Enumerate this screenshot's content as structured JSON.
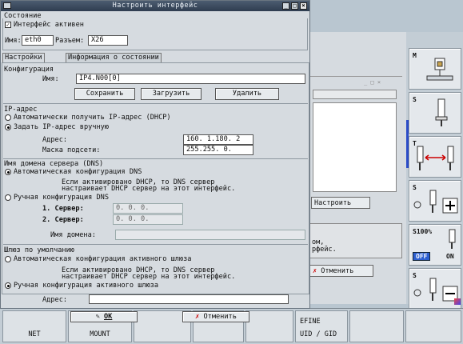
{
  "window": {
    "title": "Настроить интерфейс",
    "status_group": "Состояние",
    "iface_active_label": "Интерфейс активен",
    "name_label": "Имя:",
    "name_value": "eth0",
    "connector_label": "Разъем:",
    "connector_value": "X26"
  },
  "tabs": [
    "Настройки",
    "Информация о состоянии"
  ],
  "config": {
    "group": "Конфигурация",
    "name_label": "Имя:",
    "name_value": "IP4.N00[0]",
    "save": "Сохранить",
    "load": "Загрузить",
    "delete": "Удалить"
  },
  "ip": {
    "group": "IP-адрес",
    "auto": "Автоматически получить IP-адрес (DHCP)",
    "manual": "Задать IP-адрес вручную",
    "address_label": "Адрес:",
    "address_value": "160.  1.180. 2",
    "mask_label": "Маска подсети:",
    "mask_value": "255.255.  0."
  },
  "dns": {
    "group": "Имя домена сервера (DNS)",
    "auto": "Автоматическая конфигурация DNS",
    "note1": "Если активировано DHCP, то DNS сервер",
    "note2": "настраивает DHCP сервер на этот интерфейс.",
    "manual": "Ручная конфигурация DNS",
    "server1_label": "1. Сервер:",
    "server2_label": "2. Сервер:",
    "server_value": "0.  0.  0.",
    "domain_label": "Имя домена:"
  },
  "gateway": {
    "group": "Шлюз по умолчанию",
    "auto": "Автоматическая конфигурация активного шлюза",
    "note1": "Если активировано DHCP, то DNS сервер",
    "note2": "настраивает DHCP сервер на этот интерфейс.",
    "manual": "Ручная конфигурация активного шлюза",
    "address_label": "Адрес:"
  },
  "buttons": {
    "ok": "OK",
    "cancel": "Отменить"
  },
  "background": {
    "configure": "Настроить",
    "cancel": "Отменить",
    "text1": "ом,",
    "text2": "рфейс."
  },
  "softkeys": {
    "m": "M",
    "s1": "S",
    "t": "T",
    "s2": "S",
    "s100": "S100%",
    "off": "OFF",
    "on": "ON",
    "s3": "S"
  },
  "bottom": {
    "net": "NET",
    "mount": "MOUNT",
    "define": "EFINE",
    "uid_gid": "UID / GID"
  }
}
